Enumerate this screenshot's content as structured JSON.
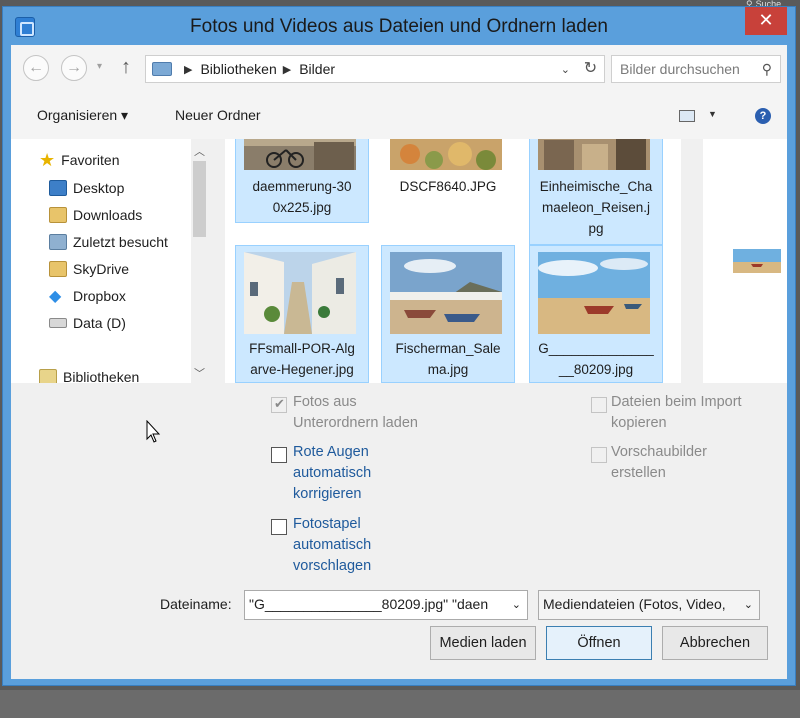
{
  "topbar": {
    "search_text": "Suche"
  },
  "window": {
    "title": "Fotos und Videos aus Dateien und Ordnern laden",
    "close_glyph": "✕"
  },
  "nav": {
    "back": "←",
    "forward": "→",
    "up": "↑",
    "refresh": "↻",
    "path": [
      "Bibliotheken",
      "Bilder"
    ],
    "search_placeholder": "Bilder durchsuchen"
  },
  "toolbar": {
    "organize": "Organisieren ▾",
    "new_folder": "Neuer Ordner",
    "help": "?"
  },
  "sidebar": {
    "items": [
      {
        "label": "Favoriten",
        "icon": "star-icon"
      },
      {
        "label": "Desktop",
        "icon": "desktop-icon"
      },
      {
        "label": "Downloads",
        "icon": "downloads-icon"
      },
      {
        "label": "Zuletzt besucht",
        "icon": "recent-icon"
      },
      {
        "label": "SkyDrive",
        "icon": "skydrive-icon"
      },
      {
        "label": "Dropbox",
        "icon": "dropbox-icon"
      },
      {
        "label": "Data (D)",
        "icon": "drive-icon"
      },
      {
        "label": "Bibliotheken",
        "icon": "libraries-icon"
      }
    ]
  },
  "files": [
    {
      "name": "daemmerung-30\n0x225.jpg",
      "selected": true
    },
    {
      "name": "DSCF8640.JPG",
      "selected": false
    },
    {
      "name": "Einheimische_Cha\nmaeleon_Reisen.j\npg",
      "selected": true
    },
    {
      "name": "FFsmall-POR-Alg\narve-Hegener.jpg",
      "selected": true
    },
    {
      "name": "Fischerman_Sale\nma.jpg",
      "selected": true
    },
    {
      "name": "G______________\n__80209.jpg",
      "selected": true
    }
  ],
  "options": {
    "subfolders": "Fotos aus\nUnterordnern laden",
    "red_eye": "Rote Augen\nautomatisch\nkorrigieren",
    "photo_stacks": "Fotostapel\nautomatisch\nvorschlagen",
    "copy_files": "Dateien beim Import\nkopieren",
    "thumbnails": "Vorschaubilder\nerstellen"
  },
  "footer": {
    "filename_label": "Dateiname:",
    "filename_value": "\"G_______________80209.jpg\" \"daen",
    "filetype_value": "Mediendateien (Fotos, Video,",
    "load_media": "Medien laden",
    "open": "Öffnen",
    "cancel": "Abbrechen"
  }
}
